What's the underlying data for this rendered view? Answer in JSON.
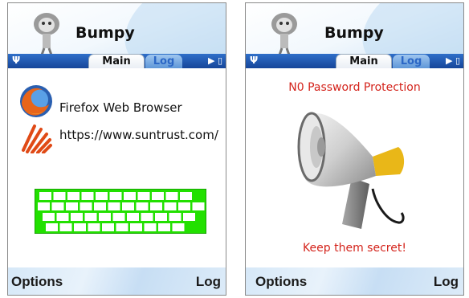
{
  "screens": [
    {
      "app_title": "Bumpy",
      "tabs": {
        "main": "Main",
        "log": "Log"
      },
      "browser_name": "Firefox Web Browser",
      "url": "https://www.suntrust.com/",
      "softkeys": {
        "left": "Options",
        "right": "Log"
      }
    },
    {
      "app_title": "Bumpy",
      "tabs": {
        "main": "Main",
        "log": "Log"
      },
      "warning": "N0 Password Protection",
      "hint": "Keep them secret!",
      "softkeys": {
        "left": "Options",
        "right": "Log"
      }
    }
  ],
  "colors": {
    "tabbar": "#1f58b3",
    "keyboard": "#22e000",
    "warning": "#d4241c"
  },
  "icons": [
    "signal-icon",
    "arrow-right-icon",
    "battery-icon",
    "firefox-icon",
    "suntrust-logo-icon",
    "keyboard-icon",
    "megaphone-icon",
    "avatar-icon"
  ]
}
